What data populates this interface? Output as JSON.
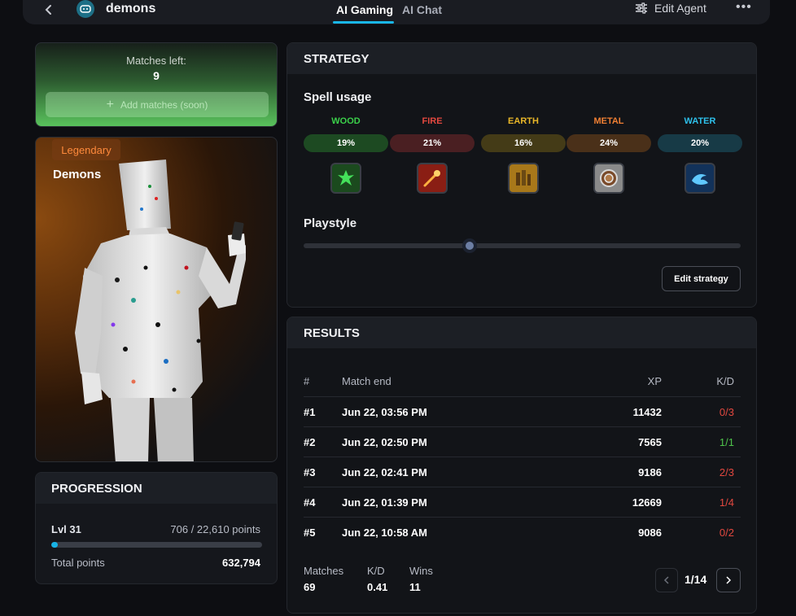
{
  "header": {
    "agent_name": "demons",
    "tabs": [
      {
        "label": "AI Gaming"
      },
      {
        "label": "AI Chat"
      }
    ],
    "edit_agent_label": "Edit Agent"
  },
  "matches": {
    "label": "Matches left:",
    "value": "9",
    "add_button_label": "Add matches (soon)"
  },
  "hero": {
    "rarity": "Legendary",
    "name": "Demons"
  },
  "progression": {
    "title": "PROGRESSION",
    "level": "Lvl 31",
    "points": "706 / 22,610 points",
    "progress_fraction": 0.031,
    "total_label": "Total points",
    "total_value": "632,794"
  },
  "strategy": {
    "title": "STRATEGY",
    "spell_usage_label": "Spell usage",
    "elements": [
      {
        "name": "WOOD",
        "percent": "19%",
        "color": "#3bd14a",
        "pill_bg": "#1d4a22",
        "icon_bg": "#1b4a1e"
      },
      {
        "name": "FIRE",
        "percent": "21%",
        "color": "#e2483f",
        "pill_bg": "#4a1f22",
        "icon_bg": "#8a1e14"
      },
      {
        "name": "EARTH",
        "percent": "16%",
        "color": "#e8b628",
        "pill_bg": "#443b17",
        "icon_bg": "#a8781a"
      },
      {
        "name": "METAL",
        "percent": "24%",
        "color": "#f07f33",
        "pill_bg": "#4a3019",
        "icon_bg": "#8a8a8a"
      },
      {
        "name": "WATER",
        "percent": "20%",
        "color": "#2ec0ea",
        "pill_bg": "#173a46",
        "icon_bg": "#12325a"
      }
    ],
    "playstyle_label": "Playstyle",
    "playstyle_value": 0.38,
    "edit_button_label": "Edit strategy"
  },
  "results": {
    "title": "RESULTS",
    "columns": [
      "#",
      "Match end",
      "XP",
      "K/D"
    ],
    "rows": [
      {
        "num": "#1",
        "end": "Jun 22, 03:56 PM",
        "xp": "11432",
        "kd": "0/3",
        "win": false
      },
      {
        "num": "#2",
        "end": "Jun 22, 02:50 PM",
        "xp": "7565",
        "kd": "1/1",
        "win": true
      },
      {
        "num": "#3",
        "end": "Jun 22, 02:41 PM",
        "xp": "9186",
        "kd": "2/3",
        "win": false
      },
      {
        "num": "#4",
        "end": "Jun 22, 01:39 PM",
        "xp": "12669",
        "kd": "1/4",
        "win": false
      },
      {
        "num": "#5",
        "end": "Jun 22, 10:58 AM",
        "xp": "9086",
        "kd": "0/2",
        "win": false
      }
    ],
    "summary": {
      "matches_label": "Matches",
      "matches_value": "69",
      "kd_label": "K/D",
      "kd_value": "0.41",
      "wins_label": "Wins",
      "wins_value": "11"
    },
    "pager": "1/14"
  }
}
